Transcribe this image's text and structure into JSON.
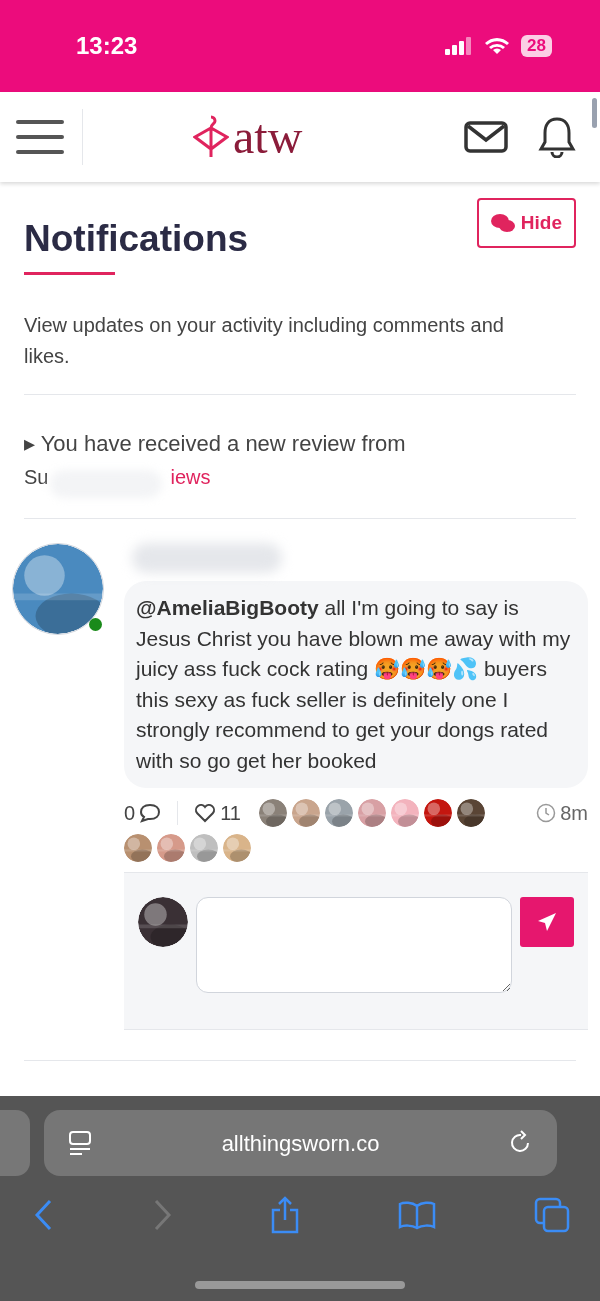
{
  "status_bar": {
    "time": "13:23",
    "battery": "28"
  },
  "header": {
    "logo": "atw"
  },
  "page": {
    "title": "Notifications",
    "hide_button": "Hide",
    "description": "View updates on your activity including comments and likes."
  },
  "notification": {
    "marker": "▸",
    "text": "You have received a new review from",
    "name_visible": "Su",
    "link_visible": "iews"
  },
  "comment": {
    "online": true,
    "mention": "@AmeliaBigBooty",
    "body": " all I'm going to say is Jesus Christ you have blown me away with my juicy ass fuck cock rating 🥵🥵🥵💦 buyers this sexy as fuck seller is definitely one I strongly recommend to get your dongs rated with so go get her booked",
    "comments_count": "0",
    "likes_count": "11",
    "time": "8m"
  },
  "browser": {
    "url": "allthingsworn.co"
  }
}
